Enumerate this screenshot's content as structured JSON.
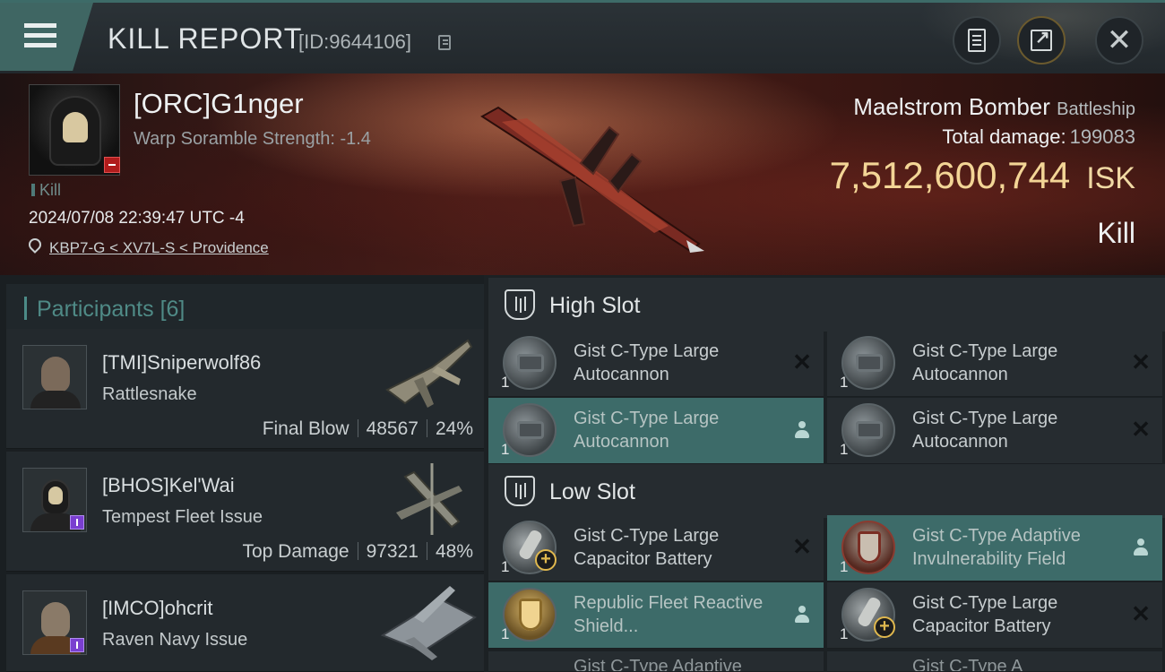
{
  "header": {
    "title": "KILL REPORT",
    "report_id": "[ID:9644106]",
    "accent_color": "#3f6663"
  },
  "victim": {
    "name": "[ORC]G1nger",
    "warp_scramble": "Warp Soramble Strength: -1.4",
    "tag": "Kill",
    "timestamp": "2024/07/08 22:39:47 UTC -4",
    "location": "KBP7-G < XV7L-S < Providence",
    "ship_name": "Maelstrom Bomber",
    "ship_class": "Battleship",
    "total_damage_label": "Total damage:",
    "total_damage": "199083",
    "isk_value": "7,512,600,744",
    "isk_unit": "ISK",
    "result": "Kill",
    "isk_color": "#f3d596"
  },
  "participants": {
    "title": "Participants",
    "count": "[6]",
    "items": [
      {
        "name": "[TMI]Sniperwolf86",
        "ship": "Rattlesnake",
        "role": "Final Blow",
        "damage": "48567",
        "percent": "24%"
      },
      {
        "name": "[BHOS]Kel'Wai",
        "ship": "Tempest Fleet Issue",
        "role": "Top Damage",
        "damage": "97321",
        "percent": "48%"
      },
      {
        "name": "[IMCO]ohcrit",
        "ship": "Raven Navy Issue"
      }
    ]
  },
  "fitting": {
    "high_slot": {
      "title": "High Slot",
      "modules": [
        {
          "name": "Gist C-Type Large Autocannon",
          "qty": "1",
          "state": "destroyed",
          "icon": "autocannon-icon"
        },
        {
          "name": "Gist C-Type Large Autocannon",
          "qty": "1",
          "state": "destroyed",
          "icon": "autocannon-icon"
        },
        {
          "name": "Gist C-Type Large Autocannon",
          "qty": "1",
          "state": "dropped",
          "icon": "autocannon-icon"
        },
        {
          "name": "Gist C-Type Large Autocannon",
          "qty": "1",
          "state": "destroyed",
          "icon": "autocannon-icon"
        }
      ]
    },
    "low_slot": {
      "title": "Low Slot",
      "modules": [
        {
          "name": "Gist C-Type Large Capacitor Battery",
          "qty": "1",
          "state": "destroyed",
          "icon": "capacitor-battery-icon"
        },
        {
          "name": "Gist C-Type Adaptive Invulnerability Field",
          "qty": "1",
          "state": "dropped",
          "icon": "invulnerability-field-icon"
        },
        {
          "name": "Republic Fleet Reactive Shield...",
          "qty": "1",
          "state": "dropped",
          "icon": "reactive-shield-icon"
        },
        {
          "name": "Gist C-Type Large Capacitor Battery",
          "qty": "1",
          "state": "destroyed",
          "icon": "capacitor-battery-icon"
        }
      ]
    },
    "partial_row": [
      "Gist C-Type Adaptive",
      "Gist C-Type A"
    ]
  }
}
